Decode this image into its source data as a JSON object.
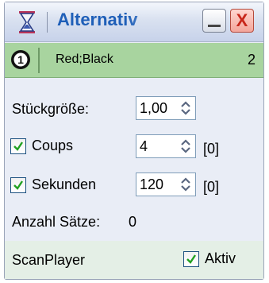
{
  "window": {
    "title": "Alternativ"
  },
  "titlebar": {
    "minimize_icon": "minimize-icon",
    "close_label": "X"
  },
  "status": {
    "badge": "1",
    "text": "Red;Black",
    "count": "2",
    "color": "#a8d49f"
  },
  "form": {
    "stueckgroesse": {
      "label": "Stückgröße:",
      "value": "1,00"
    },
    "coups": {
      "label": "Coups",
      "checked": true,
      "value": "4",
      "suffix": "[0]"
    },
    "sekunden": {
      "label": "Sekunden",
      "checked": true,
      "value": "120",
      "suffix": "[0]"
    },
    "anzahl": {
      "label": "Anzahl Sätze:",
      "value": "0"
    }
  },
  "footer": {
    "player": "ScanPlayer",
    "aktiv": {
      "label": "Aktiv",
      "checked": true
    }
  }
}
